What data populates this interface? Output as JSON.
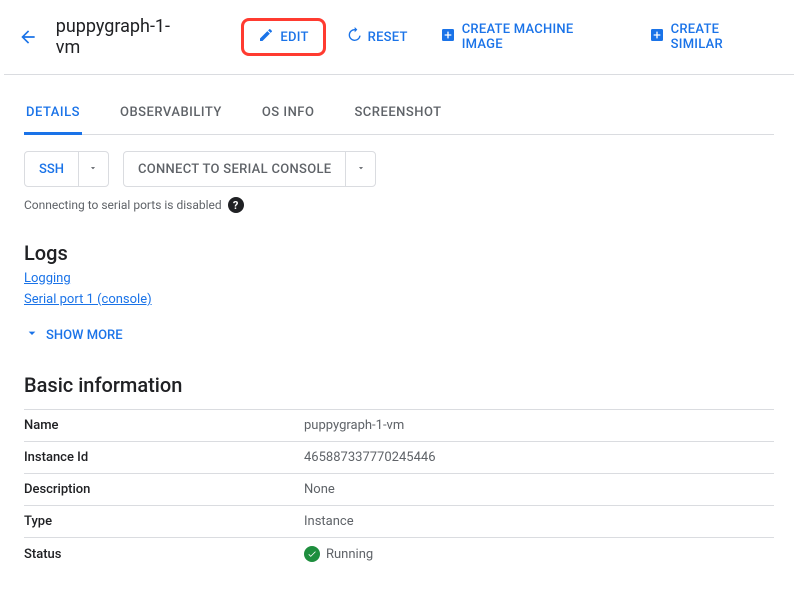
{
  "header": {
    "title": "puppygraph-1-vm",
    "edit": "EDIT",
    "reset": "RESET",
    "create_machine_image": "CREATE MACHINE IMAGE",
    "create_similar": "CREATE SIMILAR"
  },
  "tabs": {
    "details": "DETAILS",
    "observability": "OBSERVABILITY",
    "os_info": "OS INFO",
    "screenshot": "SCREENSHOT"
  },
  "buttons": {
    "ssh": "SSH",
    "serial": "CONNECT TO SERIAL CONSOLE"
  },
  "hint": "Connecting to serial ports is disabled",
  "logs": {
    "heading": "Logs",
    "logging_link": "Logging",
    "serial_link": "Serial port 1 (console)",
    "show_more": "SHOW MORE"
  },
  "basic": {
    "heading": "Basic information",
    "rows": {
      "name_k": "Name",
      "name_v": "puppygraph-1-vm",
      "instance_k": "Instance Id",
      "instance_v": "465887337770245446",
      "description_k": "Description",
      "description_v": "None",
      "type_k": "Type",
      "type_v": "Instance",
      "status_k": "Status",
      "status_v": "Running"
    }
  }
}
